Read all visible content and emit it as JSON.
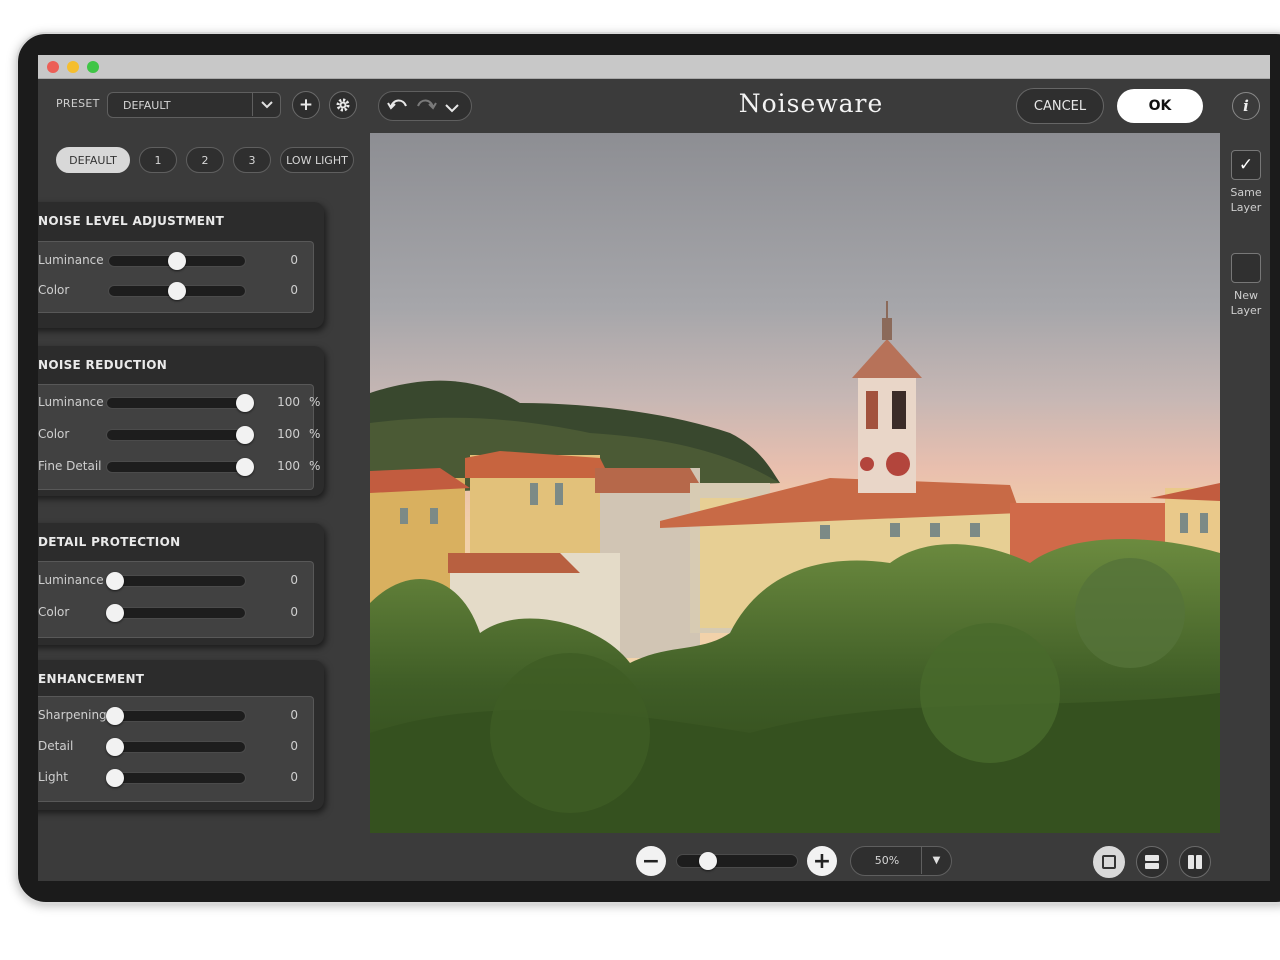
{
  "app": {
    "title": "Noiseware"
  },
  "toolbar": {
    "preset_label": "PRESET",
    "preset_value": "DEFAULT",
    "cancel_label": "CANCEL",
    "ok_label": "OK",
    "add_icon": "plus-icon",
    "settings_icon": "gear-icon",
    "undo_icon": "undo-icon",
    "redo_icon": "redo-icon",
    "history_icon": "chevron-down-icon",
    "info_icon": "info-icon"
  },
  "preset_tabs": [
    {
      "label": "DEFAULT",
      "selected": true
    },
    {
      "label": "1",
      "selected": false
    },
    {
      "label": "2",
      "selected": false
    },
    {
      "label": "3",
      "selected": false
    },
    {
      "label": "LOW LIGHT",
      "selected": false
    }
  ],
  "panels": [
    {
      "title": "NOISE LEVEL ADJUSTMENT",
      "rows": [
        {
          "label": "Luminance",
          "value": "0",
          "unit": "",
          "level": 0.5
        },
        {
          "label": "Color",
          "value": "0",
          "unit": "",
          "level": 0.5
        }
      ]
    },
    {
      "title": "NOISE REDUCTION",
      "rows": [
        {
          "label": "Luminance",
          "value": "100",
          "unit": "%",
          "level": 1.0
        },
        {
          "label": "Color",
          "value": "100",
          "unit": "%",
          "level": 1.0
        },
        {
          "label": "Fine Detail",
          "value": "100",
          "unit": "%",
          "level": 1.0
        }
      ]
    },
    {
      "title": "DETAIL PROTECTION",
      "rows": [
        {
          "label": "Luminance",
          "value": "0",
          "unit": "",
          "level": 0.0
        },
        {
          "label": "Color",
          "value": "0",
          "unit": "",
          "level": 0.0
        }
      ]
    },
    {
      "title": "ENHANCEMENT",
      "rows": [
        {
          "label": "Sharpening",
          "value": "0",
          "unit": "",
          "level": 0.0
        },
        {
          "label": "Detail",
          "value": "0",
          "unit": "",
          "level": 0.0
        },
        {
          "label": "Light",
          "value": "0",
          "unit": "",
          "level": 0.0
        }
      ]
    }
  ],
  "output": {
    "same_layer": {
      "label": "Same Layer",
      "checked": true
    },
    "new_layer": {
      "label": "New Layer",
      "checked": false
    }
  },
  "zoom": {
    "value": "50%",
    "level": 0.26
  },
  "view_modes": [
    "single-view-icon",
    "split-horizontal-icon",
    "split-vertical-icon"
  ],
  "colors": {
    "background": "#3b3b3b",
    "panel": "#2c2c2c",
    "accent": "#ffffff"
  }
}
